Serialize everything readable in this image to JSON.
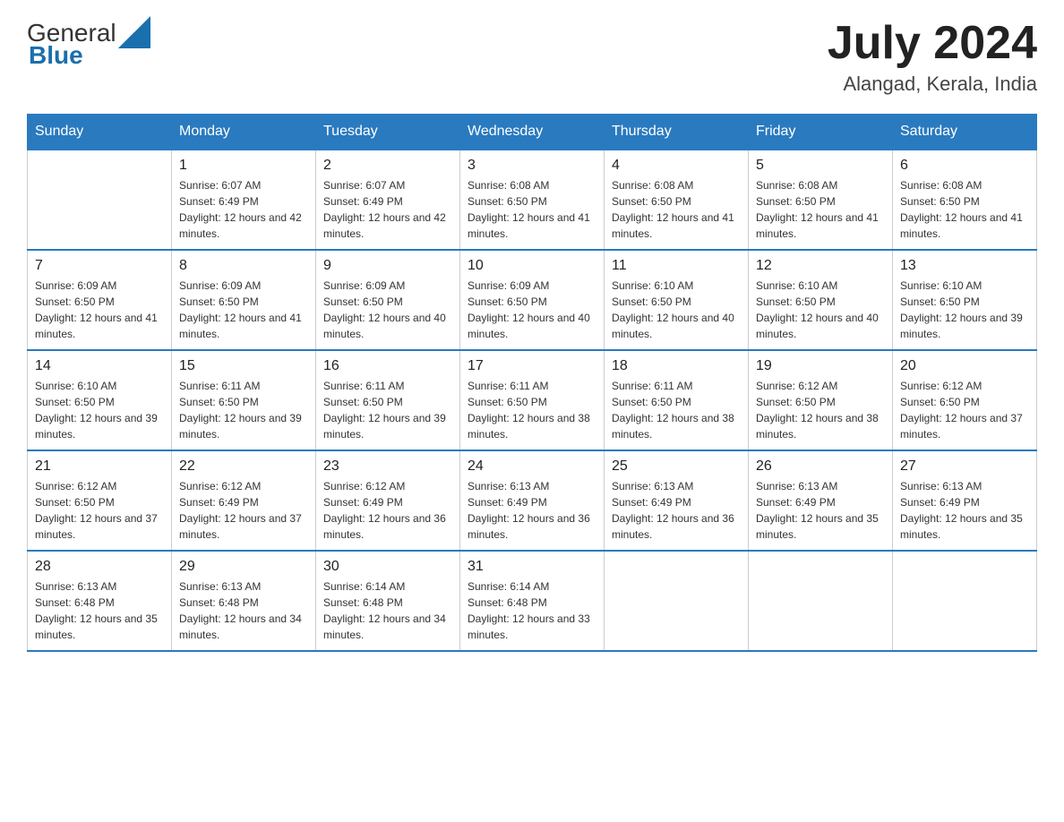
{
  "header": {
    "logo_text_general": "General",
    "logo_text_blue": "Blue",
    "month": "July 2024",
    "location": "Alangad, Kerala, India"
  },
  "weekdays": [
    "Sunday",
    "Monday",
    "Tuesday",
    "Wednesday",
    "Thursday",
    "Friday",
    "Saturday"
  ],
  "weeks": [
    [
      {
        "day": "",
        "sunrise": "",
        "sunset": "",
        "daylight": ""
      },
      {
        "day": "1",
        "sunrise": "Sunrise: 6:07 AM",
        "sunset": "Sunset: 6:49 PM",
        "daylight": "Daylight: 12 hours and 42 minutes."
      },
      {
        "day": "2",
        "sunrise": "Sunrise: 6:07 AM",
        "sunset": "Sunset: 6:49 PM",
        "daylight": "Daylight: 12 hours and 42 minutes."
      },
      {
        "day": "3",
        "sunrise": "Sunrise: 6:08 AM",
        "sunset": "Sunset: 6:50 PM",
        "daylight": "Daylight: 12 hours and 41 minutes."
      },
      {
        "day": "4",
        "sunrise": "Sunrise: 6:08 AM",
        "sunset": "Sunset: 6:50 PM",
        "daylight": "Daylight: 12 hours and 41 minutes."
      },
      {
        "day": "5",
        "sunrise": "Sunrise: 6:08 AM",
        "sunset": "Sunset: 6:50 PM",
        "daylight": "Daylight: 12 hours and 41 minutes."
      },
      {
        "day": "6",
        "sunrise": "Sunrise: 6:08 AM",
        "sunset": "Sunset: 6:50 PM",
        "daylight": "Daylight: 12 hours and 41 minutes."
      }
    ],
    [
      {
        "day": "7",
        "sunrise": "Sunrise: 6:09 AM",
        "sunset": "Sunset: 6:50 PM",
        "daylight": "Daylight: 12 hours and 41 minutes."
      },
      {
        "day": "8",
        "sunrise": "Sunrise: 6:09 AM",
        "sunset": "Sunset: 6:50 PM",
        "daylight": "Daylight: 12 hours and 41 minutes."
      },
      {
        "day": "9",
        "sunrise": "Sunrise: 6:09 AM",
        "sunset": "Sunset: 6:50 PM",
        "daylight": "Daylight: 12 hours and 40 minutes."
      },
      {
        "day": "10",
        "sunrise": "Sunrise: 6:09 AM",
        "sunset": "Sunset: 6:50 PM",
        "daylight": "Daylight: 12 hours and 40 minutes."
      },
      {
        "day": "11",
        "sunrise": "Sunrise: 6:10 AM",
        "sunset": "Sunset: 6:50 PM",
        "daylight": "Daylight: 12 hours and 40 minutes."
      },
      {
        "day": "12",
        "sunrise": "Sunrise: 6:10 AM",
        "sunset": "Sunset: 6:50 PM",
        "daylight": "Daylight: 12 hours and 40 minutes."
      },
      {
        "day": "13",
        "sunrise": "Sunrise: 6:10 AM",
        "sunset": "Sunset: 6:50 PM",
        "daylight": "Daylight: 12 hours and 39 minutes."
      }
    ],
    [
      {
        "day": "14",
        "sunrise": "Sunrise: 6:10 AM",
        "sunset": "Sunset: 6:50 PM",
        "daylight": "Daylight: 12 hours and 39 minutes."
      },
      {
        "day": "15",
        "sunrise": "Sunrise: 6:11 AM",
        "sunset": "Sunset: 6:50 PM",
        "daylight": "Daylight: 12 hours and 39 minutes."
      },
      {
        "day": "16",
        "sunrise": "Sunrise: 6:11 AM",
        "sunset": "Sunset: 6:50 PM",
        "daylight": "Daylight: 12 hours and 39 minutes."
      },
      {
        "day": "17",
        "sunrise": "Sunrise: 6:11 AM",
        "sunset": "Sunset: 6:50 PM",
        "daylight": "Daylight: 12 hours and 38 minutes."
      },
      {
        "day": "18",
        "sunrise": "Sunrise: 6:11 AM",
        "sunset": "Sunset: 6:50 PM",
        "daylight": "Daylight: 12 hours and 38 minutes."
      },
      {
        "day": "19",
        "sunrise": "Sunrise: 6:12 AM",
        "sunset": "Sunset: 6:50 PM",
        "daylight": "Daylight: 12 hours and 38 minutes."
      },
      {
        "day": "20",
        "sunrise": "Sunrise: 6:12 AM",
        "sunset": "Sunset: 6:50 PM",
        "daylight": "Daylight: 12 hours and 37 minutes."
      }
    ],
    [
      {
        "day": "21",
        "sunrise": "Sunrise: 6:12 AM",
        "sunset": "Sunset: 6:50 PM",
        "daylight": "Daylight: 12 hours and 37 minutes."
      },
      {
        "day": "22",
        "sunrise": "Sunrise: 6:12 AM",
        "sunset": "Sunset: 6:49 PM",
        "daylight": "Daylight: 12 hours and 37 minutes."
      },
      {
        "day": "23",
        "sunrise": "Sunrise: 6:12 AM",
        "sunset": "Sunset: 6:49 PM",
        "daylight": "Daylight: 12 hours and 36 minutes."
      },
      {
        "day": "24",
        "sunrise": "Sunrise: 6:13 AM",
        "sunset": "Sunset: 6:49 PM",
        "daylight": "Daylight: 12 hours and 36 minutes."
      },
      {
        "day": "25",
        "sunrise": "Sunrise: 6:13 AM",
        "sunset": "Sunset: 6:49 PM",
        "daylight": "Daylight: 12 hours and 36 minutes."
      },
      {
        "day": "26",
        "sunrise": "Sunrise: 6:13 AM",
        "sunset": "Sunset: 6:49 PM",
        "daylight": "Daylight: 12 hours and 35 minutes."
      },
      {
        "day": "27",
        "sunrise": "Sunrise: 6:13 AM",
        "sunset": "Sunset: 6:49 PM",
        "daylight": "Daylight: 12 hours and 35 minutes."
      }
    ],
    [
      {
        "day": "28",
        "sunrise": "Sunrise: 6:13 AM",
        "sunset": "Sunset: 6:48 PM",
        "daylight": "Daylight: 12 hours and 35 minutes."
      },
      {
        "day": "29",
        "sunrise": "Sunrise: 6:13 AM",
        "sunset": "Sunset: 6:48 PM",
        "daylight": "Daylight: 12 hours and 34 minutes."
      },
      {
        "day": "30",
        "sunrise": "Sunrise: 6:14 AM",
        "sunset": "Sunset: 6:48 PM",
        "daylight": "Daylight: 12 hours and 34 minutes."
      },
      {
        "day": "31",
        "sunrise": "Sunrise: 6:14 AM",
        "sunset": "Sunset: 6:48 PM",
        "daylight": "Daylight: 12 hours and 33 minutes."
      },
      {
        "day": "",
        "sunrise": "",
        "sunset": "",
        "daylight": ""
      },
      {
        "day": "",
        "sunrise": "",
        "sunset": "",
        "daylight": ""
      },
      {
        "day": "",
        "sunrise": "",
        "sunset": "",
        "daylight": ""
      }
    ]
  ]
}
